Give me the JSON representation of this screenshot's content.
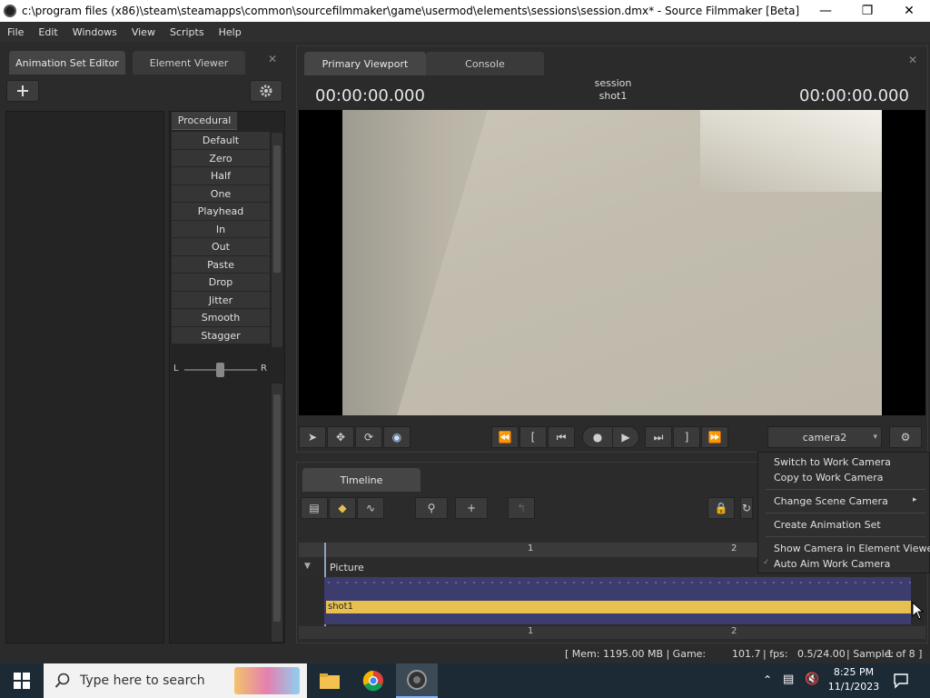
{
  "window": {
    "title": "c:\\program files (x86)\\steam\\steamapps\\common\\sourcefilmmaker\\game\\usermod\\elements\\sessions\\session.dmx* - Source Filmmaker [Beta]"
  },
  "menubar": [
    "File",
    "Edit",
    "Windows",
    "View",
    "Scripts",
    "Help"
  ],
  "left_panel": {
    "tabs": [
      "Animation Set Editor",
      "Element Viewer"
    ],
    "procedural": {
      "tab_label": "Procedural",
      "items": [
        "Default",
        "Zero",
        "Half",
        "One",
        "Playhead",
        "In",
        "Out",
        "Paste",
        "Drop",
        "Jitter",
        "Smooth",
        "Stagger"
      ],
      "slider_left": "L",
      "slider_right": "R"
    }
  },
  "viewport_panel": {
    "tabs": [
      "Primary Viewport",
      "Console"
    ],
    "timecode_left": "00:00:00.000",
    "timecode_right": "00:00:00.000",
    "session_label": "session",
    "shot_label": "shot1",
    "camera_select": "camera2"
  },
  "timeline_panel": {
    "tab": "Timeline",
    "ruler_ticks": [
      "1",
      "2"
    ],
    "track_name": "Picture",
    "clip_label": "shot1"
  },
  "context_menu": {
    "items": [
      "Switch to Work Camera",
      "Copy to Work Camera",
      "Change Scene Camera",
      "Create Animation Set",
      "Show Camera in Element Viewer",
      "Auto Aim Work Camera"
    ]
  },
  "status_bar": {
    "mem": "[ Mem: 1195.00 MB | Game:",
    "game_value": "101.7",
    "fps_label": "| fps:",
    "fps_value": "0.5/24.00",
    "sample_label": "| Sample:",
    "sample_value": "1 of 8 ]"
  },
  "taskbar": {
    "search_placeholder": "Type here to search",
    "time": "8:25 PM",
    "date": "11/1/2023"
  },
  "colors": {
    "clip": "#e8c050",
    "lane": "#3d3c6e",
    "taskbar": "#1c2a36"
  }
}
